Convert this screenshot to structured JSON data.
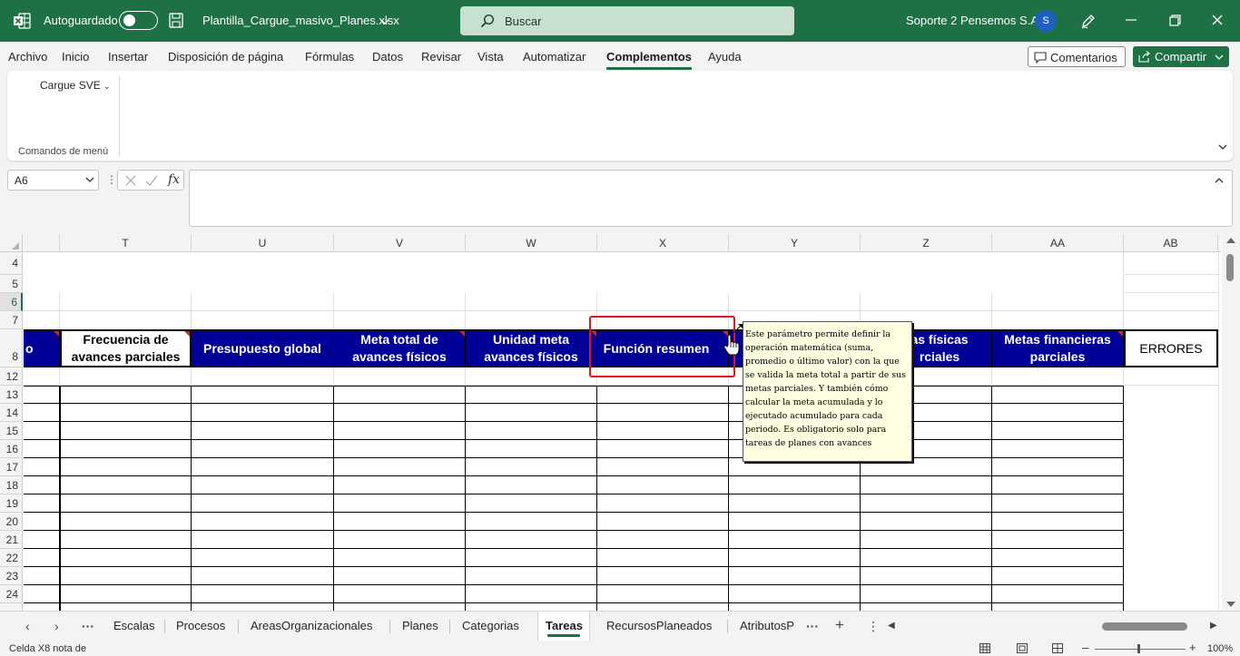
{
  "titlebar": {
    "autosave_label": "Autoguardado",
    "filename": "Plantilla_Cargue_masivo_Planes.xlsx",
    "search_label": "Buscar",
    "user_name": "Soporte 2 Pensemos S.A.",
    "avatar_initial": "S"
  },
  "menu": [
    "Archivo",
    "Inicio",
    "Insertar",
    "Disposición de página",
    "Fórmulas",
    "Datos",
    "Revisar",
    "Vista",
    "Automatizar",
    "Complementos",
    "Ayuda"
  ],
  "menu_active": "Complementos",
  "actions": {
    "comments_label": "Comentarios",
    "share_label": "Compartir"
  },
  "ribbon": {
    "cargue_label": "Cargue SVE",
    "group_label": "Comandos de menú"
  },
  "formula_bar": {
    "name_box": "A6",
    "fx_label": "fx"
  },
  "columns": [
    "T",
    "U",
    "V",
    "W",
    "X",
    "Y",
    "Z",
    "AA",
    "AB"
  ],
  "rows": [
    "4",
    "5",
    "6",
    "7",
    "8",
    "12",
    "13",
    "14",
    "15",
    "16",
    "17",
    "18",
    "19",
    "20",
    "21",
    "22",
    "23",
    "24"
  ],
  "headers": {
    "s_partial": "o",
    "t": "Frecuencia de avances parciales",
    "u": "Presupuesto global",
    "v": "Meta total de avances físicos",
    "w": "Unidad meta avances físicos",
    "x": "Función resumen",
    "z_partial": "as físicas rciales",
    "aa": "Metas financieras parciales",
    "ab": "ERRORES"
  },
  "note_text": "Este parámetro permite definir la operación matemática (suma, promedio o último valor) con la que se valida la meta total a partir de sus metas parciales. Y también cómo calcular la meta acumulada y lo ejecutado acumulado para cada periodo. Es obligatorio solo para tareas de planes con avances",
  "sheets": [
    "Escalas",
    "Procesos",
    "AreasOrganizacionales",
    "Planes",
    "Categorias",
    "Tareas",
    "RecursosPlaneados",
    "AtributosP"
  ],
  "sheet_active": "Tareas",
  "status": {
    "message": "Celda X8 nota de",
    "zoom": "100%"
  },
  "colors": {
    "excel_green": "#1e7145",
    "header_blue": "#000099",
    "note_bg": "#ffffe1",
    "highlight_red": "#e3121b"
  }
}
